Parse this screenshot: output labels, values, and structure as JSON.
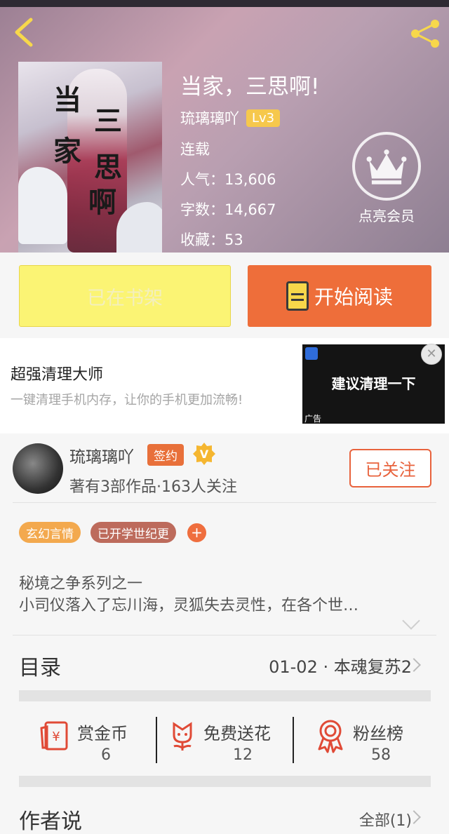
{
  "header": {
    "book_title": "当家，三思啊!",
    "author_name": "琉璃璃吖",
    "author_level": "Lv3",
    "status": "连载",
    "popularity": "人气：13,606",
    "word_count": "字数：14,667",
    "favorites": "收藏：53",
    "vip_label": "点亮会员",
    "cover_chars": [
      "当",
      "家",
      "三",
      "思",
      "啊"
    ]
  },
  "actions": {
    "shelf_label": "已在书架",
    "read_label": "开始阅读"
  },
  "ad": {
    "title": "超强清理大师",
    "description": "一键清理手机内存，让你的手机更加流畅!",
    "image_text": "建议清理一下",
    "ad_tag": "广告",
    "close_glyph": "✕"
  },
  "author": {
    "name": "琉璃璃吖",
    "sign_badge": "签约",
    "v_badge": "V",
    "meta": "著有3部作品·163人关注",
    "follow_label": "已关注"
  },
  "tags": [
    {
      "label": "玄幻言情",
      "color": "#f3a94e"
    },
    {
      "label": "已开学世纪更",
      "color": "#bd6b5c"
    }
  ],
  "tag_plus": "+",
  "intro": {
    "line1": "秘境之争系列之一",
    "line2": "小司仪落入了忘川海，灵狐失去灵性，在各个世…"
  },
  "toc": {
    "label": "目录",
    "latest": "01-02 · 本魂复苏2"
  },
  "stats": [
    {
      "label": "赏金币",
      "value": "6",
      "icon": "red-envelope-icon"
    },
    {
      "label": "免费送花",
      "value": "12",
      "icon": "flower-icon"
    },
    {
      "label": "粉丝榜",
      "value": "58",
      "icon": "medal-icon"
    }
  ],
  "author_say": {
    "label": "作者说",
    "all": "全部(1)"
  },
  "colors": {
    "accent": "#ee6e3a",
    "shelf_button": "#fbf474",
    "level_badge": "#f6c84c"
  }
}
